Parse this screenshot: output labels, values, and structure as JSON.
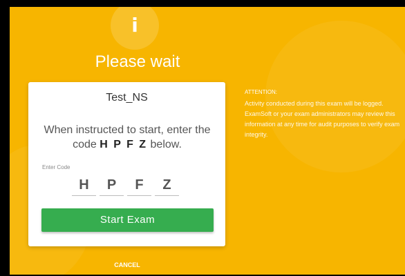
{
  "header": {
    "icon": "info-icon",
    "icon_glyph": "i",
    "title": "Please wait"
  },
  "card": {
    "exam_name": "Test_NS",
    "instruction_prefix": "When instructed to start, enter the code",
    "code": "H P F Z",
    "instruction_suffix": "below.",
    "code_label": "Enter Code",
    "code_chars": [
      "H",
      "P",
      "F",
      "Z"
    ],
    "start_label": "Start Exam"
  },
  "attention": {
    "title": "ATTENTION:",
    "body": "Activity conducted during this exam will be logged. ExamSoft or your exam administrators may review this information at any time for audit purposes to verify exam integrity."
  },
  "footer": {
    "cancel_label": "CANCEL"
  },
  "colors": {
    "background": "#f7b500",
    "button": "#36ad4f",
    "card": "#ffffff"
  }
}
